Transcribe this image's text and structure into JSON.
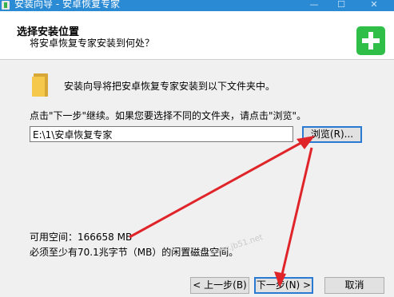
{
  "window": {
    "title": "安装向导 - 安卓恢复专家",
    "minimize": "—",
    "maximize": "☐",
    "close": "✕"
  },
  "header": {
    "title": "选择安装位置",
    "subtitle": "将安卓恢复专家安装到何处？"
  },
  "body": {
    "folder_text": "安装向导将把安卓恢复专家安装到以下文件夹中。",
    "instruction": "点击\"下一步\"继续。如果您要选择不同的文件夹，请点击\"浏览\"。",
    "path_value": "E:\\1\\安卓恢复专家",
    "browse_label": "浏览(R)...",
    "free_space": "可用空间：166658 MB",
    "required_space": "必须至少有70.1兆字节（MB）的闲置磁盘空间。"
  },
  "footer": {
    "back_label": "< 上一步(B)",
    "next_label": "下一步(N) >",
    "cancel_label": "取消"
  },
  "watermark": "www.jb51.net",
  "colors": {
    "titlebar": "#2a8ad4",
    "logo": "#2fbf48",
    "annotation": "#e0252a"
  }
}
